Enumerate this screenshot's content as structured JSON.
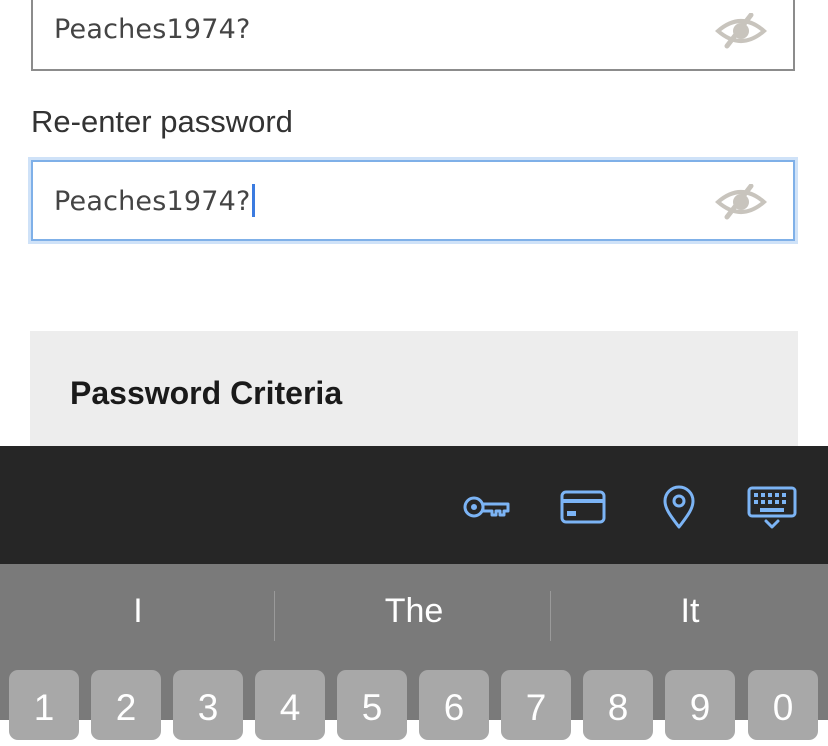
{
  "password_field": {
    "value": "Peaches1974?"
  },
  "reenter": {
    "label": "Re-enter password",
    "value": "Peaches1974?"
  },
  "criteria": {
    "title": "Password Criteria"
  },
  "accessory_bar": {
    "icons": [
      "key-icon",
      "credit-card-icon",
      "location-pin-icon",
      "keyboard-icon"
    ],
    "accent_color": "#7cb4f5"
  },
  "keyboard": {
    "suggestions": [
      "I",
      "The",
      "It"
    ],
    "number_keys": [
      "1",
      "2",
      "3",
      "4",
      "5",
      "6",
      "7",
      "8",
      "9",
      "0"
    ]
  }
}
